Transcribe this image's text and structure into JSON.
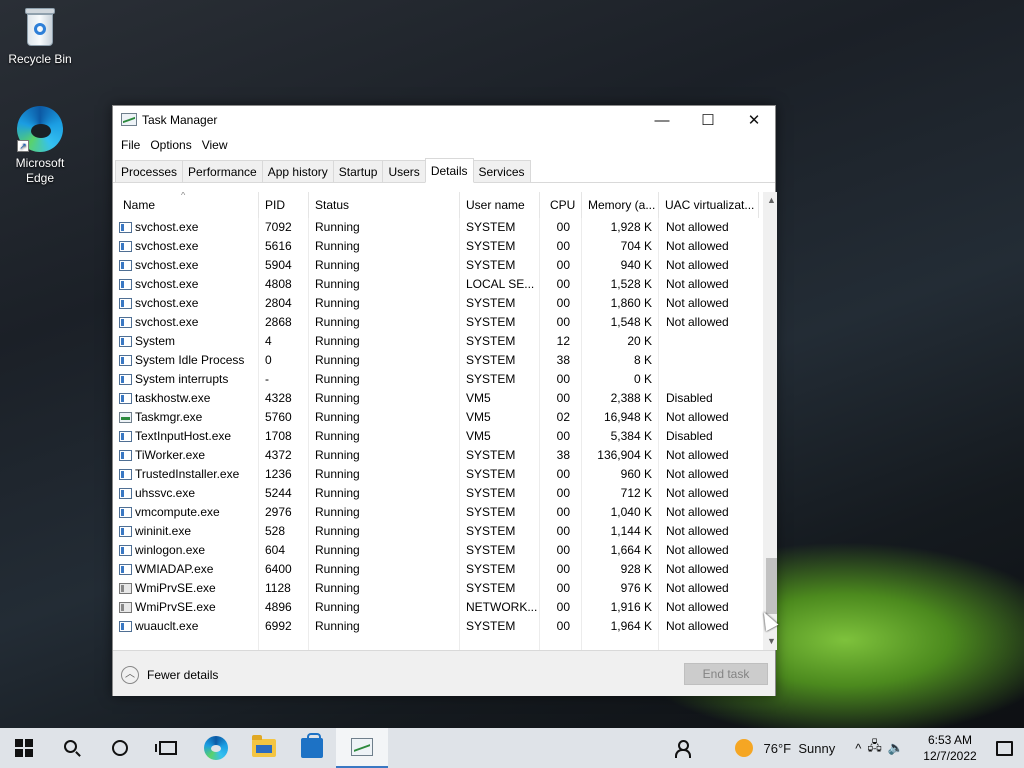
{
  "desktop": {
    "icons": [
      {
        "label": "Recycle Bin",
        "icon": "recycle-bin-icon"
      },
      {
        "label": "Microsoft Edge",
        "icon": "edge-icon"
      }
    ]
  },
  "window": {
    "title": "Task Manager",
    "controls": {
      "minimize": "—",
      "maximize": "☐",
      "close": "✕"
    },
    "menu": [
      "File",
      "Options",
      "View"
    ],
    "tabs": [
      "Processes",
      "Performance",
      "App history",
      "Startup",
      "Users",
      "Details",
      "Services"
    ],
    "active_tab": "Details",
    "columns": [
      "Name",
      "PID",
      "Status",
      "User name",
      "CPU",
      "Memory (a...",
      "UAC virtualizat..."
    ],
    "sort_indicator": "^",
    "rows": [
      {
        "name": "svchost.exe",
        "pid": "7092",
        "status": "Running",
        "user": "SYSTEM",
        "cpu": "00",
        "memory": "1,928 K",
        "uac": "Not allowed",
        "icon": "process-icon"
      },
      {
        "name": "svchost.exe",
        "pid": "5616",
        "status": "Running",
        "user": "SYSTEM",
        "cpu": "00",
        "memory": "704 K",
        "uac": "Not allowed",
        "icon": "process-icon"
      },
      {
        "name": "svchost.exe",
        "pid": "5904",
        "status": "Running",
        "user": "SYSTEM",
        "cpu": "00",
        "memory": "940 K",
        "uac": "Not allowed",
        "icon": "process-icon"
      },
      {
        "name": "svchost.exe",
        "pid": "4808",
        "status": "Running",
        "user": "LOCAL SE...",
        "cpu": "00",
        "memory": "1,528 K",
        "uac": "Not allowed",
        "icon": "process-icon"
      },
      {
        "name": "svchost.exe",
        "pid": "2804",
        "status": "Running",
        "user": "SYSTEM",
        "cpu": "00",
        "memory": "1,860 K",
        "uac": "Not allowed",
        "icon": "process-icon"
      },
      {
        "name": "svchost.exe",
        "pid": "2868",
        "status": "Running",
        "user": "SYSTEM",
        "cpu": "00",
        "memory": "1,548 K",
        "uac": "Not allowed",
        "icon": "process-icon"
      },
      {
        "name": "System",
        "pid": "4",
        "status": "Running",
        "user": "SYSTEM",
        "cpu": "12",
        "memory": "20 K",
        "uac": "",
        "icon": "process-icon"
      },
      {
        "name": "System Idle Process",
        "pid": "0",
        "status": "Running",
        "user": "SYSTEM",
        "cpu": "38",
        "memory": "8 K",
        "uac": "",
        "icon": "process-icon"
      },
      {
        "name": "System interrupts",
        "pid": "-",
        "status": "Running",
        "user": "SYSTEM",
        "cpu": "00",
        "memory": "0 K",
        "uac": "",
        "icon": "process-icon"
      },
      {
        "name": "taskhostw.exe",
        "pid": "4328",
        "status": "Running",
        "user": "VM5",
        "cpu": "00",
        "memory": "2,388 K",
        "uac": "Disabled",
        "icon": "process-icon"
      },
      {
        "name": "Taskmgr.exe",
        "pid": "5760",
        "status": "Running",
        "user": "VM5",
        "cpu": "02",
        "memory": "16,948 K",
        "uac": "Not allowed",
        "icon": "task-manager-icon"
      },
      {
        "name": "TextInputHost.exe",
        "pid": "1708",
        "status": "Running",
        "user": "VM5",
        "cpu": "00",
        "memory": "5,384 K",
        "uac": "Disabled",
        "icon": "process-icon"
      },
      {
        "name": "TiWorker.exe",
        "pid": "4372",
        "status": "Running",
        "user": "SYSTEM",
        "cpu": "38",
        "memory": "136,904 K",
        "uac": "Not allowed",
        "icon": "process-icon"
      },
      {
        "name": "TrustedInstaller.exe",
        "pid": "1236",
        "status": "Running",
        "user": "SYSTEM",
        "cpu": "00",
        "memory": "960 K",
        "uac": "Not allowed",
        "icon": "process-icon"
      },
      {
        "name": "uhssvc.exe",
        "pid": "5244",
        "status": "Running",
        "user": "SYSTEM",
        "cpu": "00",
        "memory": "712 K",
        "uac": "Not allowed",
        "icon": "process-icon"
      },
      {
        "name": "vmcompute.exe",
        "pid": "2976",
        "status": "Running",
        "user": "SYSTEM",
        "cpu": "00",
        "memory": "1,040 K",
        "uac": "Not allowed",
        "icon": "process-icon"
      },
      {
        "name": "wininit.exe",
        "pid": "528",
        "status": "Running",
        "user": "SYSTEM",
        "cpu": "00",
        "memory": "1,144 K",
        "uac": "Not allowed",
        "icon": "process-icon"
      },
      {
        "name": "winlogon.exe",
        "pid": "604",
        "status": "Running",
        "user": "SYSTEM",
        "cpu": "00",
        "memory": "1,664 K",
        "uac": "Not allowed",
        "icon": "process-icon"
      },
      {
        "name": "WMIADAP.exe",
        "pid": "6400",
        "status": "Running",
        "user": "SYSTEM",
        "cpu": "00",
        "memory": "928 K",
        "uac": "Not allowed",
        "icon": "process-icon"
      },
      {
        "name": "WmiPrvSE.exe",
        "pid": "1128",
        "status": "Running",
        "user": "SYSTEM",
        "cpu": "00",
        "memory": "976 K",
        "uac": "Not allowed",
        "icon": "gear-process-icon"
      },
      {
        "name": "WmiPrvSE.exe",
        "pid": "4896",
        "status": "Running",
        "user": "NETWORK...",
        "cpu": "00",
        "memory": "1,916 K",
        "uac": "Not allowed",
        "icon": "gear-process-icon"
      },
      {
        "name": "wuauclt.exe",
        "pid": "6992",
        "status": "Running",
        "user": "SYSTEM",
        "cpu": "00",
        "memory": "1,964 K",
        "uac": "Not allowed",
        "icon": "process-icon"
      }
    ],
    "footer": {
      "fewer_details": "Fewer details",
      "end_task": "End task"
    }
  },
  "taskbar": {
    "pinned": [
      "start-icon",
      "search-icon",
      "cortana-icon",
      "task-view-icon",
      "edge-icon",
      "file-explorer-icon",
      "store-icon",
      "task-manager-icon"
    ],
    "weather": {
      "temp": "76°F",
      "condition": "Sunny"
    },
    "tray_chevron": "^",
    "time": "6:53 AM",
    "date": "12/7/2022"
  },
  "colors": {
    "accent": "#3a78c3",
    "taskbar": "#dfe3e8",
    "window_bg": "#ffffff"
  }
}
